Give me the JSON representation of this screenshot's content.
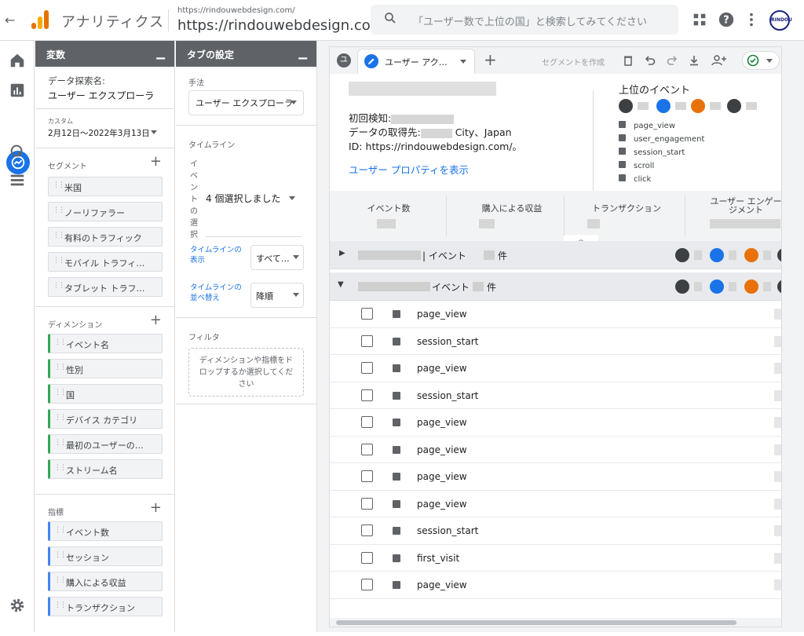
{
  "topbar": {
    "app_name": "アナリティクス",
    "url_small": "https://rindouwebdesign.com/",
    "url_big": "https://rindouwebdesign.com/",
    "search_placeholder": "「ユーザー数で上位の国」と検索してみてください",
    "avatar_text": "RINDOU"
  },
  "variables": {
    "header": "変数",
    "exploration_label": "データ探索名:",
    "exploration_name": "ユーザー エクスプローラ",
    "date_label": "カスタム",
    "date_range": "2月12日～2022年3月13日",
    "segments_title": "セグメント",
    "segments": [
      "米国",
      "ノーリファラー",
      "有料のトラフィック",
      "モバイル トラフィ…",
      "タブレット トラフ…"
    ],
    "dimensions_title": "ディメンション",
    "dimensions": [
      "イベント名",
      "性別",
      "国",
      "デバイス カテゴリ",
      "最初のユーザーの…",
      "ストリーム名"
    ],
    "metrics_title": "指標",
    "metrics": [
      "イベント数",
      "セッション",
      "購入による収益",
      "トランザクション"
    ]
  },
  "tab_settings": {
    "header": "タブの設定",
    "technique_label": "手法",
    "technique_value": "ユーザー エクスプローラ",
    "timeline_title": "タイムライン",
    "event_select_label": "イベントの選択",
    "event_select_value": "4 個選択しました",
    "timeline_display_label": "タイムラインの表示",
    "timeline_display_value": "すべて…",
    "timeline_sort_label": "タイムラインの並べ替え",
    "timeline_sort_value": "降順",
    "filter_title": "フィルタ",
    "filter_placeholder": "ディメンションや指標をドロップするか選択してください"
  },
  "canvas": {
    "tab_number": "ユ",
    "tab_label": "ユーザー アク…",
    "segment_create": "セグメントを作成",
    "first_seen_label": "初回検知:",
    "data_source_label": "データの取得先:",
    "data_source_value": "City、Japan",
    "id_label": "ID:",
    "id_value": "https://rindouwebdesign.com/。",
    "user_props_link": "ユーザー プロパティを表示",
    "top_events_title": "上位のイベント",
    "top_events": [
      "page_view",
      "user_engagement",
      "session_start",
      "scroll",
      "click"
    ],
    "columns": [
      "イベント数",
      "購入による収益",
      "トランザクション",
      "ユーザー エンゲージメント"
    ],
    "group1_text": "| イベント",
    "group1_suffix": "件",
    "group2_text": "イベント",
    "group2_suffix": "件",
    "rows": [
      "page_view",
      "session_start",
      "page_view",
      "session_start",
      "page_view",
      "page_view",
      "page_view",
      "page_view",
      "session_start",
      "first_visit",
      "page_view"
    ]
  },
  "colors": {
    "accent": "#1a73e8",
    "orange": "#e8710a",
    "dark_icon": "#3c4043",
    "panel_header": "#5f6368"
  }
}
